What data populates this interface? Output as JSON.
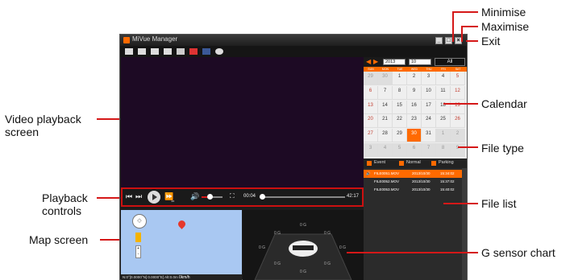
{
  "window": {
    "title": "MiVue Manager",
    "buttons": [
      "_",
      "□",
      "×"
    ]
  },
  "toolbar": {
    "icons": [
      "open-folder-icon",
      "print-icon",
      "save-icon",
      "snapshot-icon",
      "wifi-icon",
      "youtube-icon",
      "facebook-icon",
      "settings-icon"
    ]
  },
  "playback": {
    "time_current": "00:04",
    "time_total": "42:17",
    "speed": "1x"
  },
  "map": {
    "status": "N:0°[0.0000°N] 0.0000°E] Alt:0.0m",
    "speed": "0km/h"
  },
  "gsensor": {
    "labels": [
      "0 G",
      "0 G",
      "0 G",
      "0 G",
      "0 G",
      "0 G",
      "0 G",
      "0 G"
    ]
  },
  "calendar": {
    "year": "2013",
    "month": "10",
    "all_label": "All",
    "dow": [
      "SUN",
      "MON",
      "TUE",
      "WED",
      "THU",
      "FRI",
      "SAT"
    ],
    "weeks": [
      [
        "29",
        "30",
        "1",
        "2",
        "3",
        "4",
        "5"
      ],
      [
        "6",
        "7",
        "8",
        "9",
        "10",
        "11",
        "12"
      ],
      [
        "13",
        "14",
        "15",
        "16",
        "17",
        "18",
        "19"
      ],
      [
        "20",
        "21",
        "22",
        "23",
        "24",
        "25",
        "26"
      ],
      [
        "27",
        "28",
        "29",
        "30",
        "31",
        "1",
        "2"
      ],
      [
        "3",
        "4",
        "5",
        "6",
        "7",
        "8",
        "9"
      ]
    ],
    "selected_day": "30"
  },
  "filetype": {
    "event": "Event",
    "normal": "Normal",
    "parking": "Parking"
  },
  "files": [
    {
      "name": "FILE0051.MOV",
      "date": "2013/10/30",
      "time": "15:34:02"
    },
    {
      "name": "FILE0052.MOV",
      "date": "2013/10/30",
      "time": "15:37:02"
    },
    {
      "name": "FILE0053.MOV",
      "date": "2013/10/30",
      "time": "15:40:02"
    }
  ],
  "callouts": {
    "minimise": "Minimise",
    "maximise": "Maximise",
    "exit": "Exit",
    "video": "Video playback screen",
    "calendar": "Calendar",
    "filetype": "File type",
    "playback": "Playback controls",
    "filelist": "File list",
    "map": "Map screen",
    "gsensor": "G sensor chart"
  },
  "colors": {
    "accent": "#ff6a00",
    "callout_line": "#d51818"
  }
}
